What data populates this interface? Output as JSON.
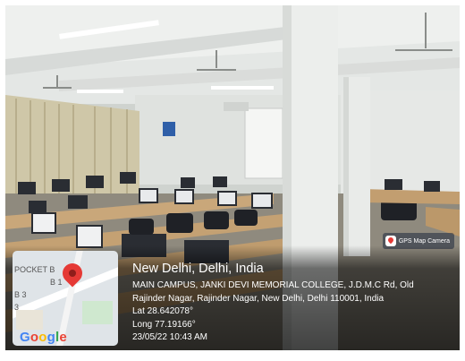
{
  "overlay": {
    "app_label": "GPS Map Camera",
    "city": "New Delhi, Delhi, India",
    "address_line1": "MAIN CAMPUS, JANKI DEVI MEMORIAL COLLEGE, J.D.M.C Rd, Old",
    "address_line2": "Rajinder Nagar, Rajinder Nagar, New Delhi, Delhi 110001, India",
    "latitude": "Lat 28.642078°",
    "longitude": "Long 77.19166°",
    "datetime": "23/05/22 10:43 AM"
  },
  "map": {
    "label_pocket": "POCKET B",
    "label_b1": "B 1",
    "label_b3": "B 3",
    "label_3": "3",
    "google": [
      "G",
      "o",
      "o",
      "g",
      "l",
      "e"
    ],
    "google_colors": [
      "#4285F4",
      "#EA4335",
      "#FBBC05",
      "#4285F4",
      "#34A853",
      "#EA4335"
    ]
  }
}
